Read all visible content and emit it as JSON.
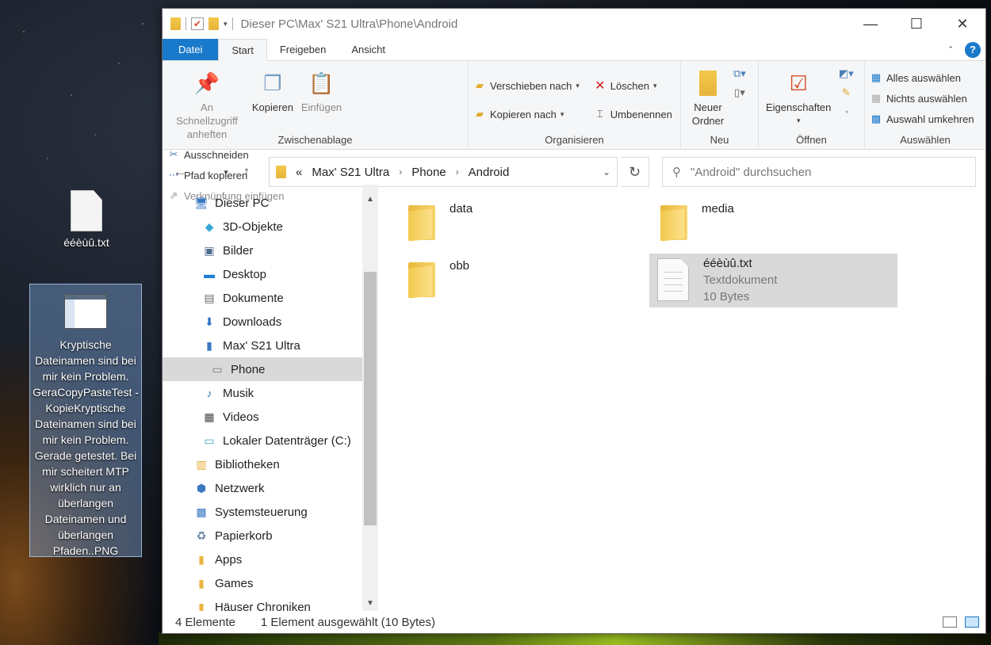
{
  "desktop": {
    "icons": [
      {
        "label": "ééèùû.txt"
      },
      {
        "label": "Kryptische Dateinamen sind bei mir kein Problem. GeraCopyPasteTest - KopieKryptische Dateinamen sind bei mir kein Problem. Gerade getestet. Bei mir scheitert MTP wirklich nur an überlangen Dateinamen und überlangen Pfaden..PNG"
      }
    ]
  },
  "window": {
    "title": "Dieser PC\\Max' S21 Ultra\\Phone\\Android",
    "controls": {
      "minimize": "—",
      "maximize": "☐",
      "close": "✕"
    }
  },
  "tabs": [
    "Datei",
    "Start",
    "Freigeben",
    "Ansicht"
  ],
  "ribbon": {
    "clipboard": {
      "label": "Zwischenablage",
      "pin": "An Schnellzugriff anheften",
      "copy": "Kopieren",
      "paste": "Einfügen",
      "cut": "Ausschneiden",
      "copy_path": "Pfad kopieren",
      "paste_shortcut": "Verknüpfung einfügen"
    },
    "organize": {
      "label": "Organisieren",
      "move_to": "Verschieben nach",
      "copy_to": "Kopieren nach",
      "delete": "Löschen",
      "rename": "Umbenennen"
    },
    "new": {
      "label": "Neu",
      "new_folder": "Neuer Ordner"
    },
    "open": {
      "label": "Öffnen",
      "properties": "Eigenschaften"
    },
    "select": {
      "label": "Auswählen",
      "select_all": "Alles auswählen",
      "select_none": "Nichts auswählen",
      "invert": "Auswahl umkehren"
    }
  },
  "address": {
    "prefix": "«",
    "segments": [
      "Max' S21 Ultra",
      "Phone",
      "Android"
    ]
  },
  "search": {
    "placeholder": "\"Android\" durchsuchen"
  },
  "tree": [
    {
      "label": "Dieser PC",
      "icon": "computer-icon",
      "indent": 0
    },
    {
      "label": "3D-Objekte",
      "icon": "cube-icon",
      "indent": 1
    },
    {
      "label": "Bilder",
      "icon": "pictures-icon",
      "indent": 1
    },
    {
      "label": "Desktop",
      "icon": "desktop-icon",
      "indent": 1
    },
    {
      "label": "Dokumente",
      "icon": "documents-icon",
      "indent": 1
    },
    {
      "label": "Downloads",
      "icon": "download-icon",
      "indent": 1
    },
    {
      "label": "Max' S21 Ultra",
      "icon": "phone-icon",
      "indent": 1
    },
    {
      "label": "Phone",
      "icon": "storage-icon",
      "indent": 2,
      "selected": true
    },
    {
      "label": "Musik",
      "icon": "music-icon",
      "indent": 1
    },
    {
      "label": "Videos",
      "icon": "video-icon",
      "indent": 1
    },
    {
      "label": "Lokaler Datenträger (C:)",
      "icon": "drive-icon",
      "indent": 1
    },
    {
      "label": "Bibliotheken",
      "icon": "libraries-icon",
      "indent": 0
    },
    {
      "label": "Netzwerk",
      "icon": "network-icon",
      "indent": 0
    },
    {
      "label": "Systemsteuerung",
      "icon": "control-panel-icon",
      "indent": 0
    },
    {
      "label": "Papierkorb",
      "icon": "recycle-bin-icon",
      "indent": 0
    },
    {
      "label": "Apps",
      "icon": "folder-icon",
      "indent": 0
    },
    {
      "label": "Games",
      "icon": "folder-icon",
      "indent": 0
    },
    {
      "label": "Häuser Chroniken",
      "icon": "folder-icon",
      "indent": 0
    }
  ],
  "files": [
    {
      "name": "data",
      "type": "folder"
    },
    {
      "name": "media",
      "type": "folder"
    },
    {
      "name": "obb",
      "type": "folder"
    },
    {
      "name": "ééèùû.txt",
      "type": "Textdokument",
      "size": "10 Bytes",
      "selected": true
    }
  ],
  "status": {
    "count": "4 Elemente",
    "selection": "1 Element ausgewählt (10 Bytes)"
  },
  "colors": {
    "accent": "#1979ca",
    "selection": "#d9d9d9"
  }
}
